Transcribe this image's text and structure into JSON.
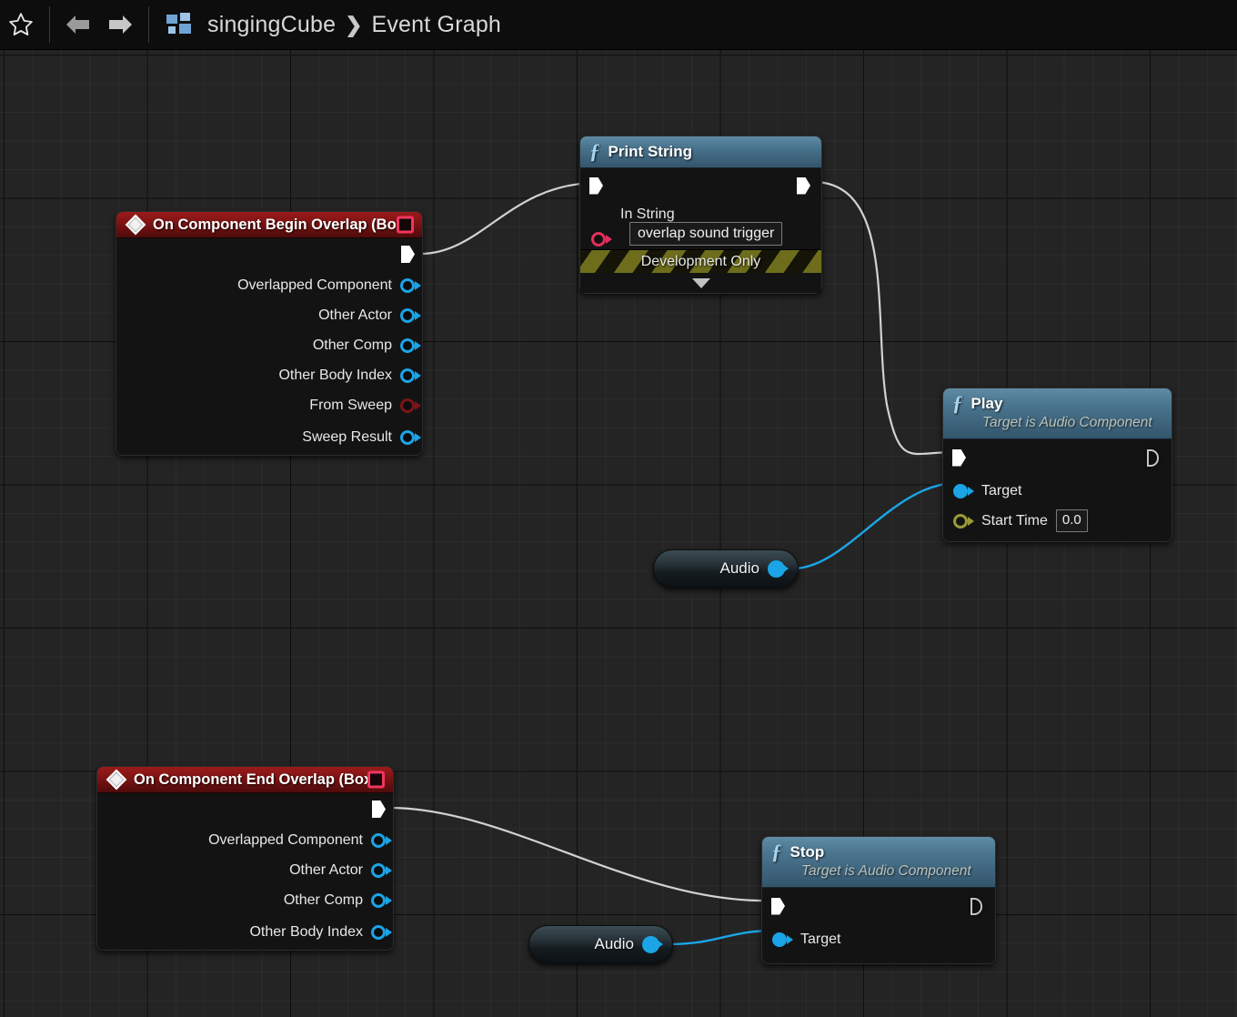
{
  "toolbar": {
    "star_icon": "star-icon",
    "back_icon": "back-arrow-icon",
    "forward_icon": "forward-arrow-icon",
    "blueprint_icon": "blueprint-icon",
    "breadcrumb_root": "singingCube",
    "breadcrumb_sep": "❯",
    "breadcrumb_leaf": "Event Graph"
  },
  "colors": {
    "event_header": "#7d1313",
    "function_header": "#4a748e",
    "exec_wire": "#d2d2d2",
    "data_wire": "#1ba4e6",
    "object_pin": "#1ba4e6",
    "bool_pin": "#7a1418",
    "string_pin": "#e0305c",
    "float_pin": "#9a9a38",
    "delegate_box": "#f0365f",
    "dev_stripe": "#6d6d1c",
    "canvas": "#242424"
  },
  "nodes": {
    "begin_overlap": {
      "title": "On Component Begin Overlap (Box)",
      "pins": [
        {
          "label": "Overlapped Component",
          "type": "object"
        },
        {
          "label": "Other Actor",
          "type": "object"
        },
        {
          "label": "Other Comp",
          "type": "object"
        },
        {
          "label": "Other Body Index",
          "type": "object"
        },
        {
          "label": "From Sweep",
          "type": "bool"
        },
        {
          "label": "Sweep Result",
          "type": "object"
        }
      ]
    },
    "end_overlap": {
      "title": "On Component End Overlap (Box)",
      "pins": [
        {
          "label": "Overlapped Component",
          "type": "object"
        },
        {
          "label": "Other Actor",
          "type": "object"
        },
        {
          "label": "Other Comp",
          "type": "object"
        },
        {
          "label": "Other Body Index",
          "type": "object"
        }
      ]
    },
    "print_string": {
      "title": "Print String",
      "in_string_label": "In String",
      "in_string_value": "overlap sound trigger",
      "dev_banner": "Development Only"
    },
    "play": {
      "title": "Play",
      "subtitle": "Target is Audio Component",
      "target_label": "Target",
      "start_time_label": "Start Time",
      "start_time_value": "0.0"
    },
    "stop": {
      "title": "Stop",
      "subtitle": "Target is Audio Component",
      "target_label": "Target"
    },
    "audio_var_top": {
      "label": "Audio"
    },
    "audio_var_bottom": {
      "label": "Audio"
    }
  }
}
